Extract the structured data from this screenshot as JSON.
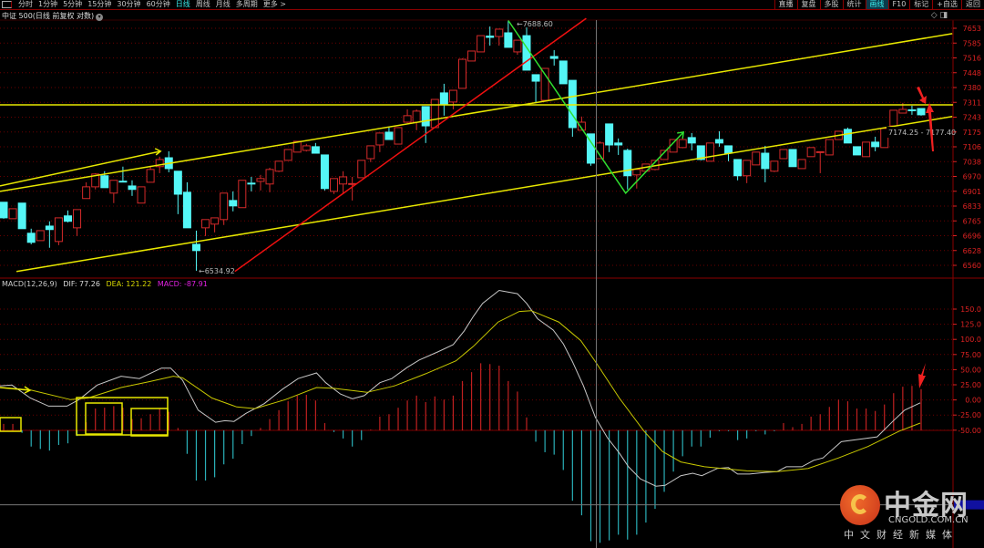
{
  "toolbar": {
    "left": [
      "分时",
      "1分钟",
      "5分钟",
      "15分钟",
      "30分钟",
      "60分钟",
      "日线",
      "周线",
      "月线",
      "多周期",
      "更多 >"
    ],
    "left_active": 6,
    "right": [
      "直播",
      "复盘",
      "多股",
      "统计",
      "画线",
      "F10",
      "标记",
      "+自选",
      "返回"
    ],
    "right_active": 4
  },
  "title": "中证 500(日线 前复权 对数)",
  "top_icons": {
    "diamond": "◇",
    "toggle": "◨"
  },
  "macd_legend": {
    "name": "MACD(12,26,9)",
    "dif": "DIF: 77.26",
    "dea": "DEA: 121.22",
    "macd": "MACD: -87.91"
  },
  "colors": {
    "up": "#d42a2a",
    "down": "#54f6f6",
    "dif": "#c8c8c8",
    "dea": "#c8c800",
    "macd_label": "#e020e0",
    "axis": "#d22",
    "grid": "#6a0000"
  },
  "watermark": {
    "cn": "中金网",
    "en": "CNGOLD.COM.CN",
    "sub": "中文财经新媒体"
  },
  "chart_data": {
    "type": "candlestick",
    "price_axis": {
      "ticks": [
        "7653",
        "7585",
        "7516",
        "7448",
        "7380",
        "7311",
        "7243",
        "7175",
        "7106",
        "7038",
        "6970",
        "6901",
        "6833",
        "6765",
        "6696",
        "6628",
        "6560"
      ],
      "range": [
        6560,
        7653
      ]
    },
    "macd_axis": {
      "ticks": [
        "150.0",
        "125.0",
        "100.0",
        "75.00",
        "50.00",
        "25.00",
        "0.00",
        "-25.00",
        "-50.00"
      ],
      "range": [
        -50,
        150
      ]
    },
    "candles_ohlc": [
      [
        6851,
        6779,
        6851,
        6775
      ],
      [
        6775,
        6821,
        6821,
        6775
      ],
      [
        6847,
        6729,
        6847,
        6729
      ],
      [
        6708,
        6666,
        6729,
        6657
      ],
      [
        6674,
        6720,
        6720,
        6674
      ],
      [
        6741,
        6725,
        6763,
        6641
      ],
      [
        6670,
        6779,
        6779,
        6653
      ],
      [
        6788,
        6763,
        6813,
        6758
      ],
      [
        6733,
        6817,
        6817,
        6695
      ],
      [
        6868,
        6922,
        6943,
        6868
      ],
      [
        6922,
        6981,
        6985,
        6910
      ],
      [
        6973,
        6918,
        6994,
        6918
      ],
      [
        6893,
        6952,
        6952,
        6847
      ],
      [
        6948,
        6945,
        7015,
        6943
      ],
      [
        6926,
        6910,
        6952,
        6880
      ],
      [
        6847,
        6922,
        6922,
        6847
      ],
      [
        6943,
        7002,
        7019,
        6943
      ],
      [
        7015,
        7048,
        7061,
        6985
      ],
      [
        7056,
        7006,
        7086,
        6989
      ],
      [
        6994,
        6888,
        6994,
        6796
      ],
      [
        6897,
        6733,
        6943,
        6733
      ],
      [
        6657,
        6628,
        6720,
        6535
      ],
      [
        6733,
        6771,
        6771,
        6695
      ],
      [
        6750,
        6779,
        6779,
        6712
      ],
      [
        6771,
        6893,
        6893,
        6746
      ],
      [
        6859,
        6834,
        6901,
        6809
      ],
      [
        6826,
        6952,
        6952,
        6826
      ],
      [
        6939,
        6935,
        6968,
        6901
      ],
      [
        6947,
        6960,
        6977,
        6905
      ],
      [
        6935,
        7002,
        7010,
        6897
      ],
      [
        6994,
        7040,
        7040,
        6990
      ],
      [
        7044,
        7094,
        7094,
        7044
      ],
      [
        7082,
        7132,
        7132,
        7082
      ],
      [
        7090,
        7111,
        7120,
        7085
      ],
      [
        7107,
        7077,
        7124,
        7077
      ],
      [
        7069,
        6914,
        7069,
        6905
      ],
      [
        6901,
        6960,
        6960,
        6889
      ],
      [
        6935,
        6968,
        6994,
        6889
      ],
      [
        6933,
        6937,
        6968,
        6859
      ],
      [
        6964,
        7044,
        7044,
        6964
      ],
      [
        7052,
        7111,
        7111,
        7036
      ],
      [
        7115,
        7170,
        7170,
        7082
      ],
      [
        7174,
        7140,
        7195,
        7140
      ],
      [
        7119,
        7195,
        7195,
        7119
      ],
      [
        7220,
        7250,
        7279,
        7216
      ],
      [
        7220,
        7271,
        7279,
        7183
      ],
      [
        7292,
        7203,
        7292,
        7124
      ],
      [
        7195,
        7325,
        7325,
        7195
      ],
      [
        7355,
        7304,
        7397,
        7250
      ],
      [
        7313,
        7367,
        7367,
        7279
      ],
      [
        7376,
        7510,
        7514,
        7376
      ],
      [
        7502,
        7548,
        7548,
        7502
      ],
      [
        7544,
        7619,
        7619,
        7544
      ],
      [
        7617,
        7611,
        7661,
        7573
      ],
      [
        7615,
        7649,
        7649,
        7573
      ],
      [
        7632,
        7565,
        7688.6,
        7565
      ],
      [
        7544,
        7598,
        7598,
        7531
      ],
      [
        7619,
        7460,
        7657,
        7460
      ],
      [
        7439,
        7409,
        7439,
        7308
      ],
      [
        7321,
        7468,
        7468,
        7321
      ],
      [
        7523,
        7514,
        7552,
        7481
      ],
      [
        7502,
        7397,
        7502,
        7397
      ],
      [
        7413,
        7195,
        7413,
        7153
      ],
      [
        7183,
        7220,
        7246,
        7183
      ],
      [
        7166,
        7031,
        7166,
        7019
      ],
      [
        7052,
        7124,
        7132,
        7052
      ],
      [
        7212,
        7115,
        7212,
        7082
      ],
      [
        7124,
        7115,
        7145,
        7069
      ],
      [
        7090,
        6973,
        7098,
        6910
      ],
      [
        6977,
        7002,
        7002,
        6914
      ],
      [
        6994,
        7027,
        7027,
        6990
      ],
      [
        7002,
        7044,
        7044,
        6998
      ],
      [
        7048,
        7090,
        7090,
        7048
      ],
      [
        7082,
        7140,
        7140,
        7082
      ],
      [
        7103,
        7140,
        7145,
        7100
      ],
      [
        7149,
        7124,
        7170,
        7090
      ],
      [
        7111,
        7048,
        7111,
        7044
      ],
      [
        7040,
        7124,
        7124,
        7040
      ],
      [
        7140,
        7124,
        7178,
        7107
      ],
      [
        7111,
        7077,
        7111,
        7040
      ],
      [
        7048,
        6973,
        7048,
        6952
      ],
      [
        6973,
        7044,
        7044,
        6939
      ],
      [
        7023,
        7082,
        7082,
        7023
      ],
      [
        7077,
        7006,
        7111,
        6943
      ],
      [
        6994,
        7040,
        7040,
        6990
      ],
      [
        7052,
        7094,
        7094,
        7050
      ],
      [
        7094,
        7015,
        7094,
        7015
      ],
      [
        7006,
        7048,
        7048,
        7006
      ],
      [
        7061,
        7103,
        7103,
        7061
      ],
      [
        7080,
        7084,
        7084,
        6985
      ],
      [
        7069,
        7140,
        7140,
        7069
      ],
      [
        7140,
        7178,
        7178,
        7140
      ],
      [
        7187,
        7124,
        7195,
        7124
      ],
      [
        7107,
        7069,
        7107,
        7069
      ],
      [
        7061,
        7128,
        7128,
        7061
      ],
      [
        7128,
        7107,
        7153,
        7086
      ],
      [
        7103,
        7191,
        7191,
        7103
      ],
      [
        7203,
        7275,
        7275,
        7203
      ],
      [
        7262,
        7279,
        7309,
        7262
      ],
      [
        7277,
        7273,
        7296,
        7254
      ],
      [
        7283,
        7254,
        7283,
        7250
      ]
    ],
    "macd_hist": [
      8,
      8,
      -3,
      -20,
      -23,
      -25,
      -18,
      -16,
      -7,
      10,
      27,
      28,
      30,
      28,
      14,
      15,
      20,
      27,
      23,
      3,
      -29,
      -62,
      -62,
      -58,
      -42,
      -35,
      -17,
      -7,
      3,
      14,
      25,
      36,
      43,
      44,
      37,
      9,
      -2,
      -10,
      -20,
      -12,
      1,
      17,
      20,
      28,
      37,
      43,
      35,
      42,
      38,
      43,
      61,
      72,
      83,
      82,
      80,
      61,
      48,
      16,
      -14,
      -27,
      -30,
      -49,
      -87,
      -105,
      -137,
      -139,
      -136,
      -129,
      -135,
      -129,
      -114,
      -97,
      -76,
      -51,
      -32,
      -20,
      -20,
      -9,
      -1,
      -1,
      -12,
      -10,
      -1,
      -5,
      -1,
      9,
      4,
      8,
      17,
      20,
      29,
      38,
      36,
      27,
      27,
      24,
      32,
      46,
      54,
      55,
      51
    ],
    "dif": [
      [
        -0.4,
        55
      ],
      [
        0.9,
        56
      ],
      [
        2.9,
        40
      ],
      [
        4.9,
        30
      ],
      [
        6.9,
        30
      ],
      [
        8.2,
        38
      ],
      [
        10.2,
        56
      ],
      [
        12.8,
        67
      ],
      [
        14.8,
        64
      ],
      [
        17.2,
        77
      ],
      [
        18.2,
        77
      ],
      [
        19.5,
        62
      ],
      [
        21.2,
        25
      ],
      [
        23.1,
        10
      ],
      [
        24.1,
        12
      ],
      [
        25.1,
        11
      ],
      [
        26.4,
        21
      ],
      [
        28.4,
        33
      ],
      [
        30.4,
        51
      ],
      [
        32.1,
        64
      ],
      [
        34.1,
        71
      ],
      [
        35.1,
        59
      ],
      [
        36.7,
        45
      ],
      [
        38.0,
        39
      ],
      [
        39.3,
        43
      ],
      [
        41.0,
        59
      ],
      [
        42.3,
        64
      ],
      [
        44.0,
        78
      ],
      [
        45.3,
        87
      ],
      [
        47.3,
        97
      ],
      [
        49.0,
        106
      ],
      [
        50.2,
        123
      ],
      [
        51.2,
        141
      ],
      [
        52.2,
        157
      ],
      [
        54.0,
        173
      ],
      [
        56.0,
        169
      ],
      [
        57.0,
        157
      ],
      [
        58.2,
        138
      ],
      [
        59.9,
        124
      ],
      [
        61.0,
        107
      ],
      [
        62.0,
        85
      ],
      [
        63.2,
        55
      ],
      [
        64.5,
        16
      ],
      [
        65.8,
        -9
      ],
      [
        67.1,
        -28
      ],
      [
        68.1,
        -45
      ],
      [
        69.4,
        -60
      ],
      [
        71.1,
        -69
      ],
      [
        72.1,
        -68
      ],
      [
        73.8,
        -56
      ],
      [
        75.1,
        -53
      ],
      [
        76.1,
        -56
      ],
      [
        77.8,
        -47
      ],
      [
        79.0,
        -46
      ],
      [
        80.0,
        -54
      ],
      [
        81.3,
        -54
      ],
      [
        83.0,
        -52
      ],
      [
        84.3,
        -51
      ],
      [
        85.3,
        -45
      ],
      [
        87.0,
        -45
      ],
      [
        88.3,
        -37
      ],
      [
        89.3,
        -34
      ],
      [
        91.3,
        -14
      ],
      [
        92.6,
        -12
      ],
      [
        93.9,
        -10
      ],
      [
        95.2,
        -8
      ],
      [
        96.9,
        11
      ],
      [
        98.2,
        25
      ],
      [
        99.9,
        34
      ]
    ],
    "dea": [
      [
        -0.4,
        53
      ],
      [
        2.9,
        50
      ],
      [
        7.3,
        38
      ],
      [
        9.2,
        40
      ],
      [
        12.8,
        53
      ],
      [
        15.8,
        60
      ],
      [
        18.5,
        67
      ],
      [
        19.5,
        65
      ],
      [
        22.7,
        40
      ],
      [
        25.4,
        29
      ],
      [
        27.4,
        27
      ],
      [
        30.7,
        38
      ],
      [
        34.1,
        53
      ],
      [
        36.0,
        52
      ],
      [
        39.6,
        47
      ],
      [
        42.6,
        55
      ],
      [
        46.0,
        70
      ],
      [
        49.3,
        86
      ],
      [
        51.2,
        104
      ],
      [
        53.9,
        134
      ],
      [
        56.2,
        147
      ],
      [
        57.5,
        148
      ],
      [
        60.5,
        134
      ],
      [
        62.9,
        111
      ],
      [
        64.5,
        85
      ],
      [
        67.1,
        40
      ],
      [
        69.8,
        -1
      ],
      [
        71.8,
        -26
      ],
      [
        73.8,
        -39
      ],
      [
        76.4,
        -45
      ],
      [
        81.0,
        -50
      ],
      [
        84.3,
        -51
      ],
      [
        87.7,
        -47
      ],
      [
        91.0,
        -34
      ],
      [
        94.2,
        -20
      ],
      [
        97.6,
        -1
      ],
      [
        99.9,
        9
      ]
    ],
    "annotations": {
      "high_label": "7688.60",
      "low_label": "6534.92",
      "range_label": "7174.25 - 7177.40",
      "horizontal_line_price": 7300,
      "upper_channel": [
        [
          -0.4,
          6901
        ],
        [
          103.4,
          7628
        ]
      ],
      "lower_channel": [
        [
          1.4,
          6532
        ],
        [
          103.4,
          7246
        ]
      ],
      "short_arrow": [
        [
          -0.4,
          6926
        ],
        [
          17.1,
          7086
        ]
      ],
      "red_trend": [
        [
          25.2,
          6532
        ],
        [
          63.5,
          7699
        ]
      ],
      "green_zigzag": [
        [
          55,
          7688.6
        ],
        [
          67.8,
          6893
        ],
        [
          74.1,
          7174
        ]
      ],
      "cursor_index": 64.6,
      "cursor_macd_value": -92
    }
  }
}
